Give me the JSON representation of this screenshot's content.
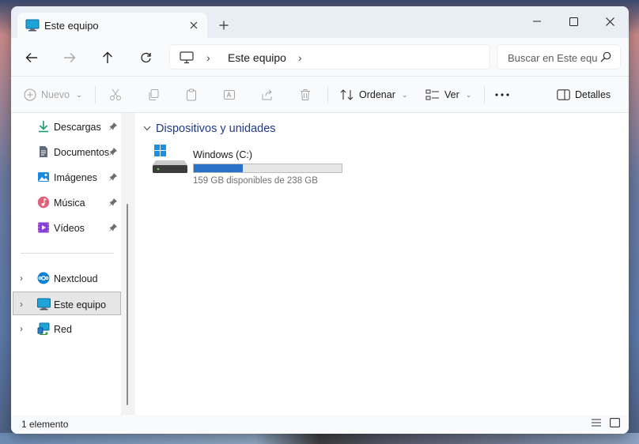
{
  "tab": {
    "title": "Este equipo",
    "icon": "pc-icon"
  },
  "address": {
    "location": "Este equipo"
  },
  "search": {
    "placeholder": "Buscar en Este equipo"
  },
  "commands": {
    "new_label": "Nuevo",
    "sort_label": "Ordenar",
    "view_label": "Ver",
    "details_label": "Detalles"
  },
  "sidebar": {
    "quick": [
      {
        "label": "Descargas",
        "icon": "download-icon"
      },
      {
        "label": "Documentos",
        "icon": "document-icon"
      },
      {
        "label": "Imágenes",
        "icon": "image-icon"
      },
      {
        "label": "Música",
        "icon": "music-icon"
      },
      {
        "label": "Vídeos",
        "icon": "video-icon"
      }
    ],
    "locations": [
      {
        "label": "Nextcloud",
        "icon": "nextcloud-icon"
      },
      {
        "label": "Este equipo",
        "icon": "pc-icon",
        "selected": true
      },
      {
        "label": "Red",
        "icon": "network-icon"
      }
    ]
  },
  "main": {
    "group_title": "Dispositivos y unidades",
    "drives": [
      {
        "name": "Windows (C:)",
        "free_text": "159 GB disponibles de 238 GB",
        "used_fraction": 0.332
      }
    ]
  },
  "status": {
    "items_text": "1 elemento"
  },
  "colors": {
    "accent": "#2a72c8",
    "group_title": "#1e3a8a",
    "selection": "#e6e6e6"
  }
}
